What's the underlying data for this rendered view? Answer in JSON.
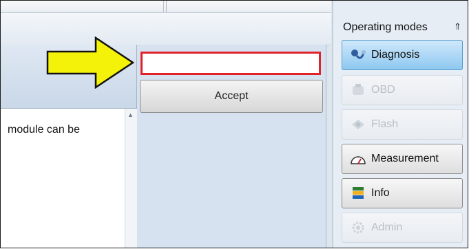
{
  "main": {
    "content_text": "module can be",
    "input_value": "",
    "accept_label": "Accept"
  },
  "side_panel": {
    "title": "Operating modes",
    "collapse_glyph": "»",
    "modes": [
      {
        "label": "Diagnosis",
        "state": "active",
        "icon": "stethoscope-icon"
      },
      {
        "label": "OBD",
        "state": "disabled",
        "icon": "car-icon"
      },
      {
        "label": "Flash",
        "state": "disabled",
        "icon": "chip-icon"
      },
      {
        "label": "Measurement",
        "state": "normal",
        "icon": "gauge-icon"
      },
      {
        "label": "Info",
        "state": "normal",
        "icon": "books-icon"
      },
      {
        "label": "Admin",
        "state": "disabled",
        "icon": "admin-gear-icon"
      }
    ]
  },
  "colors": {
    "highlight_border": "#e0222b",
    "arrow_fill": "#f5f20a",
    "active_mode": "#8ec8f0"
  }
}
